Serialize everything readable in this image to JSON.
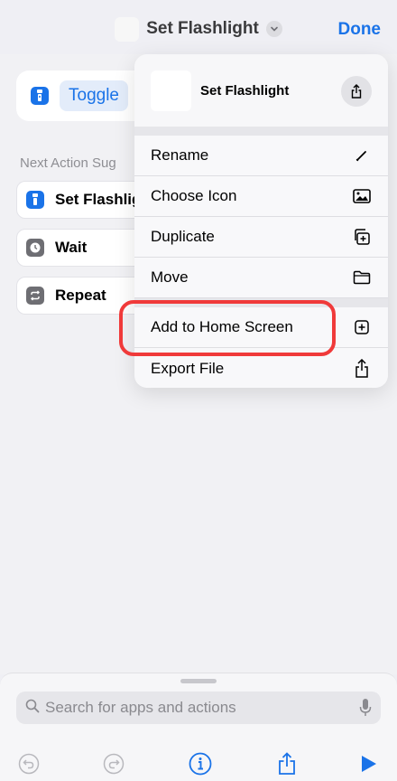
{
  "nav": {
    "title": "Set Flashlight",
    "done_label": "Done"
  },
  "action": {
    "verb": "Toggle"
  },
  "suggestions": {
    "header": "Next Action Sug",
    "items": [
      {
        "label": "Set Flashlig",
        "icon": "flashlight-icon",
        "color": "#1a73e8"
      },
      {
        "label": "Wait",
        "icon": "clock-icon",
        "color": "#6e6e73"
      },
      {
        "label": "Repeat",
        "icon": "repeat-icon",
        "color": "#6e6e73"
      }
    ]
  },
  "menu": {
    "title": "Set Flashlight",
    "items": [
      {
        "label": "Rename",
        "icon": "pencil-icon"
      },
      {
        "label": "Choose Icon",
        "icon": "photo-icon"
      },
      {
        "label": "Duplicate",
        "icon": "duplicate-icon"
      },
      {
        "label": "Move",
        "icon": "folder-icon"
      },
      {
        "label": "Add to Home Screen",
        "icon": "add-square-icon"
      },
      {
        "label": "Export File",
        "icon": "share-icon"
      }
    ]
  },
  "search": {
    "placeholder": "Search for apps and actions"
  },
  "colors": {
    "accent": "#1a73e8",
    "highlight": "#f03a3a"
  }
}
